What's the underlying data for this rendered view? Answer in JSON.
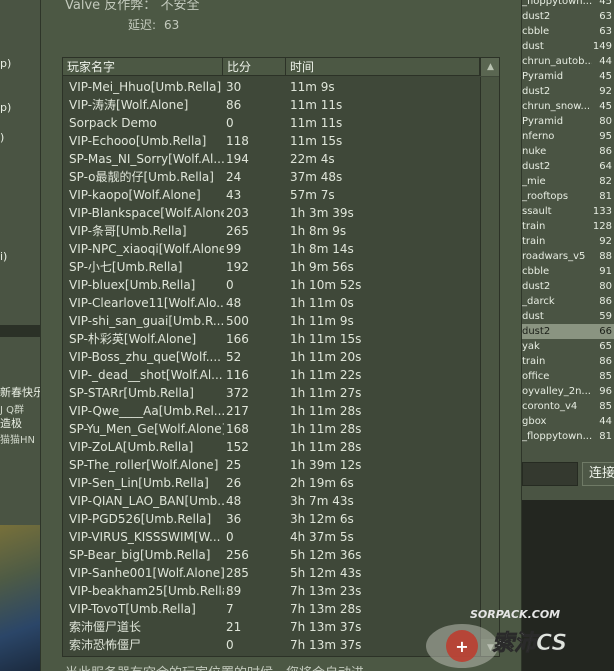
{
  "dialog": {
    "server_label": "Valve 反作弊：",
    "server_status": "不安全",
    "ping_label": "延迟:",
    "ping_value": "63",
    "columns": {
      "name": "玩家名字",
      "score": "比分",
      "time": "时间"
    },
    "players": [
      {
        "name": "VIP-Mei_Hhuo[Umb.Rella]",
        "score": "30",
        "time": "11m 9s"
      },
      {
        "name": "VIP-涛涛[Wolf.Alone]",
        "score": "86",
        "time": "11m 11s"
      },
      {
        "name": "Sorpack Demo",
        "score": "0",
        "time": "11m 11s"
      },
      {
        "name": "VIP-Echooo[Umb.Rella]",
        "score": "118",
        "time": "11m 15s"
      },
      {
        "name": "SP-Mas_NI_Sorry[Wolf.Al...",
        "score": "194",
        "time": "22m 4s"
      },
      {
        "name": "SP-o最靓的仔[Umb.Rella]",
        "score": "24",
        "time": "37m 48s"
      },
      {
        "name": "VIP-kaopo[Wolf.Alone]",
        "score": "43",
        "time": "57m 7s"
      },
      {
        "name": "VIP-Blankspace[Wolf.Alone]",
        "score": "203",
        "time": "1h 3m 39s"
      },
      {
        "name": "VIP-条哥[Umb.Rella]",
        "score": "265",
        "time": "1h 8m 9s"
      },
      {
        "name": "VIP-NPC_xiaoqi[Wolf.Alone]",
        "score": "99",
        "time": "1h 8m 14s"
      },
      {
        "name": "SP-小七[Umb.Rella]",
        "score": "192",
        "time": "1h 9m 56s"
      },
      {
        "name": "VIP-bluex[Umb.Rella]",
        "score": "0",
        "time": "1h 10m 52s"
      },
      {
        "name": "VIP-Clearlove11[Wolf.Alo...",
        "score": "48",
        "time": "1h 11m 0s"
      },
      {
        "name": "VIP-shi_san_guai[Umb.R...",
        "score": "500",
        "time": "1h 11m 9s"
      },
      {
        "name": "SP-朴彩英[Wolf.Alone]",
        "score": "166",
        "time": "1h 11m 15s"
      },
      {
        "name": "VIP-Boss_zhu_que[Wolf....",
        "score": "52",
        "time": "1h 11m 20s"
      },
      {
        "name": "VIP-_dead__shot[Wolf.Al...",
        "score": "116",
        "time": "1h 11m 22s"
      },
      {
        "name": "SP-STARr[Umb.Rella]",
        "score": "372",
        "time": "1h 11m 27s"
      },
      {
        "name": "VIP-Qwe____Aa[Umb.Rel...",
        "score": "217",
        "time": "1h 11m 28s"
      },
      {
        "name": "SP-Yu_Men_Ge[Wolf.Alone]",
        "score": "168",
        "time": "1h 11m 28s"
      },
      {
        "name": "VIP-ZoLA[Umb.Rella]",
        "score": "152",
        "time": "1h 11m 28s"
      },
      {
        "name": "SP-The_roller[Wolf.Alone]",
        "score": "25",
        "time": "1h 39m 12s"
      },
      {
        "name": "VIP-Sen_Lin[Umb.Rella]",
        "score": "26",
        "time": "2h 19m 6s"
      },
      {
        "name": "VIP-QIAN_LAO_BAN[Umb....",
        "score": "48",
        "time": "3h 7m 43s"
      },
      {
        "name": "VIP-PGD526[Umb.Rella]",
        "score": "36",
        "time": "3h 12m 6s"
      },
      {
        "name": "VIP-VIRUS_KISSSWIM[W...",
        "score": "0",
        "time": "4h 37m 5s"
      },
      {
        "name": "SP-Bear_big[Umb.Rella]",
        "score": "256",
        "time": "5h 12m 36s"
      },
      {
        "name": "VIP-Sanhe001[Wolf.Alone]",
        "score": "285",
        "time": "5h 12m 43s"
      },
      {
        "name": "VIP-beakham25[Umb.Rella]",
        "score": "89",
        "time": "7h 13m 23s"
      },
      {
        "name": "VIP-TovoT[Umb.Rella]",
        "score": "7",
        "time": "7h 13m 28s"
      },
      {
        "name": "索沛僵尸道长",
        "score": "21",
        "time": "7h 13m 37s"
      },
      {
        "name": "索沛恐怖僵尸",
        "score": "0",
        "time": "7h 13m 37s"
      }
    ],
    "footer_note": "当此服务器有空余的玩家位置的时候，您将会自动进"
  },
  "background": {
    "left_fragments": [
      "p)",
      "p)",
      ")",
      "i)",
      "新春快乐",
      "J Q群",
      "造极",
      "猫猫HN"
    ],
    "right_maps": [
      {
        "name": "_floppytown...",
        "ping": "45"
      },
      {
        "name": "dust2",
        "ping": "63"
      },
      {
        "name": "cbble",
        "ping": "63"
      },
      {
        "name": "dust",
        "ping": "149"
      },
      {
        "name": "chrun_autob...",
        "ping": "44"
      },
      {
        "name": "Pyramid",
        "ping": "45"
      },
      {
        "name": "dust2",
        "ping": "92"
      },
      {
        "name": "chrun_snow...",
        "ping": "45"
      },
      {
        "name": "Pyramid",
        "ping": "80"
      },
      {
        "name": "nferno",
        "ping": "95"
      },
      {
        "name": "nuke",
        "ping": "86"
      },
      {
        "name": "dust2",
        "ping": "64"
      },
      {
        "name": "_mie",
        "ping": "82"
      },
      {
        "name": "_rooftops",
        "ping": "81"
      },
      {
        "name": "ssault",
        "ping": "133"
      },
      {
        "name": "train",
        "ping": "128"
      },
      {
        "name": "train",
        "ping": "92"
      },
      {
        "name": "roadwars_v5",
        "ping": "88"
      },
      {
        "name": "cbble",
        "ping": "91"
      },
      {
        "name": "dust2",
        "ping": "80"
      },
      {
        "name": "_darck",
        "ping": "86"
      },
      {
        "name": "dust",
        "ping": "59"
      },
      {
        "name": "dust2",
        "ping": "66"
      },
      {
        "name": "yak",
        "ping": "65"
      },
      {
        "name": "train",
        "ping": "86"
      },
      {
        "name": "office",
        "ping": "85"
      },
      {
        "name": "oyvalley_2n...",
        "ping": "96"
      },
      {
        "name": "coronto_v4",
        "ping": "85"
      },
      {
        "name": "gbox",
        "ping": "44"
      },
      {
        "name": "_floppytown...",
        "ping": "81"
      }
    ],
    "selected_map_index": 22,
    "connect_label": "连接"
  },
  "watermark": {
    "site": "SORPACK.COM",
    "brand": "索沛CS"
  }
}
